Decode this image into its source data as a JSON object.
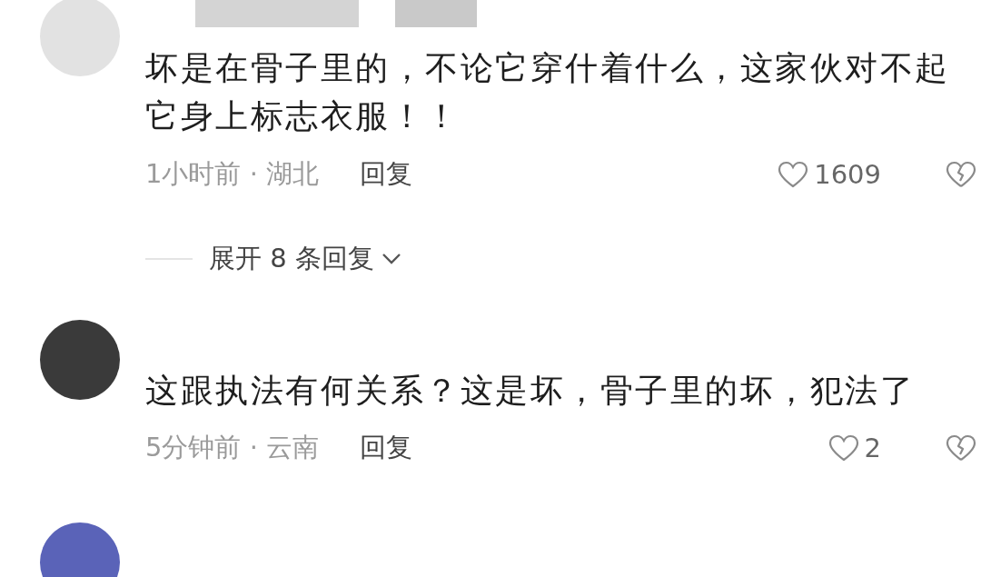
{
  "comments": [
    {
      "color": "#e2e2e2",
      "name_redacted": true,
      "text": "坏是在骨子里的，不论它穿什着什么，这家伙对不起它身上标志衣服！！",
      "time": "1小时前 · 湖北",
      "reply": "回复",
      "likes": "1609",
      "replies_toggle": "展开 8 条回复"
    },
    {
      "color": "#3a3a3a",
      "text": "这跟执法有何关系？这是坏，骨子里的坏，犯法了",
      "time": "5分钟前 · 云南",
      "reply": "回复",
      "likes": "2"
    },
    {
      "color": "#5a63b8"
    }
  ]
}
